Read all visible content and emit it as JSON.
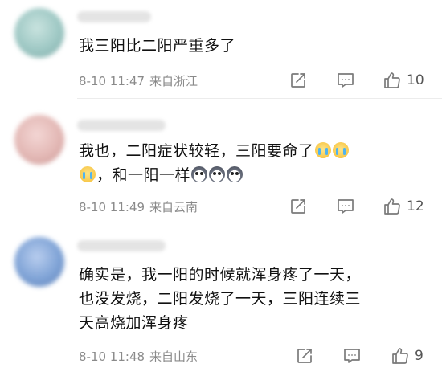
{
  "comments": [
    {
      "lines": [
        "我三阳比二阳严重多了"
      ],
      "time": "8-10 11:47",
      "source": "来自浙江",
      "likes": "10",
      "avatar_color": "#9ec8c4"
    },
    {
      "lines": [
        "我也，二阳症状较轻，三阳要命了",
        "，和一阳一样"
      ],
      "time": "8-10 11:49",
      "source": "来自云南",
      "likes": "12",
      "avatar_color": "#e3b8b5"
    },
    {
      "lines": [
        "确实是，我一阳的时候就浑身疼了一天，",
        "也没发烧，二阳发烧了一天，三阳连续三",
        "天高烧加浑身疼"
      ],
      "time": "8-10 11:48",
      "source": "来自山东",
      "likes": "9",
      "avatar_color": "#7fa3d6"
    }
  ],
  "icons": {
    "forward": "share-edit-icon",
    "reply": "comment-bubble-icon",
    "like": "thumbs-up-icon",
    "emoji_cry": "loudly-crying-face-emoji",
    "emoji_husky": "husky-dog-emoji"
  }
}
